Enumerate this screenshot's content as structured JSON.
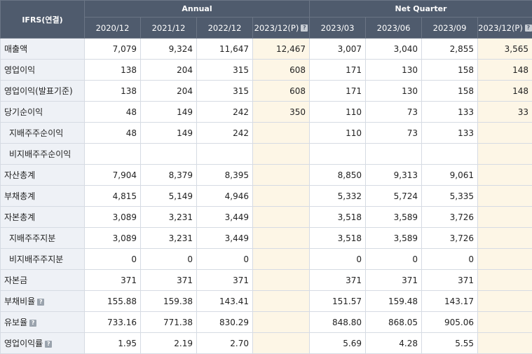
{
  "header": {
    "corner": "IFRS(연결)",
    "group_annual": "Annual",
    "group_quarter": "Net Quarter",
    "periods": [
      "2020/12",
      "2021/12",
      "2022/12",
      "2023/12(P)",
      "2023/03",
      "2023/06",
      "2023/09",
      "2023/12(P)"
    ]
  },
  "rows": [
    {
      "label": "매출액",
      "values": [
        "7,079",
        "9,324",
        "11,647",
        "12,467",
        "3,007",
        "3,040",
        "2,855",
        "3,565"
      ]
    },
    {
      "label": "영업이익",
      "values": [
        "138",
        "204",
        "315",
        "608",
        "171",
        "130",
        "158",
        "148"
      ]
    },
    {
      "label": "영업이익(발표기준)",
      "values": [
        "138",
        "204",
        "315",
        "608",
        "171",
        "130",
        "158",
        "148"
      ]
    },
    {
      "label": "당기순이익",
      "values": [
        "48",
        "149",
        "242",
        "350",
        "110",
        "73",
        "133",
        "33"
      ]
    },
    {
      "label": "지배주주순이익",
      "values": [
        "48",
        "149",
        "242",
        "",
        "110",
        "73",
        "133",
        ""
      ]
    },
    {
      "label": "비지배주주순이익",
      "values": [
        "",
        "",
        "",
        "",
        "",
        "",
        "",
        ""
      ]
    },
    {
      "label": "자산총계",
      "values": [
        "7,904",
        "8,379",
        "8,395",
        "",
        "8,850",
        "9,313",
        "9,061",
        ""
      ]
    },
    {
      "label": "부채총계",
      "values": [
        "4,815",
        "5,149",
        "4,946",
        "",
        "5,332",
        "5,724",
        "5,335",
        ""
      ]
    },
    {
      "label": "자본총계",
      "values": [
        "3,089",
        "3,231",
        "3,449",
        "",
        "3,518",
        "3,589",
        "3,726",
        ""
      ]
    },
    {
      "label": "지배주주지분",
      "values": [
        "3,089",
        "3,231",
        "3,449",
        "",
        "3,518",
        "3,589",
        "3,726",
        ""
      ]
    },
    {
      "label": "비지배주주지분",
      "values": [
        "0",
        "0",
        "0",
        "",
        "0",
        "0",
        "0",
        ""
      ]
    },
    {
      "label": "자본금",
      "values": [
        "371",
        "371",
        "371",
        "",
        "371",
        "371",
        "371",
        ""
      ]
    },
    {
      "label": "부채비율",
      "values": [
        "155.88",
        "159.38",
        "143.41",
        "",
        "151.57",
        "159.48",
        "143.17",
        ""
      ]
    },
    {
      "label": "유보율",
      "values": [
        "733.16",
        "771.38",
        "830.29",
        "",
        "848.80",
        "868.05",
        "905.06",
        ""
      ]
    },
    {
      "label": "영업이익률",
      "values": [
        "1.95",
        "2.19",
        "2.70",
        "",
        "5.69",
        "4.28",
        "5.55",
        ""
      ]
    }
  ],
  "help_icon": "?"
}
